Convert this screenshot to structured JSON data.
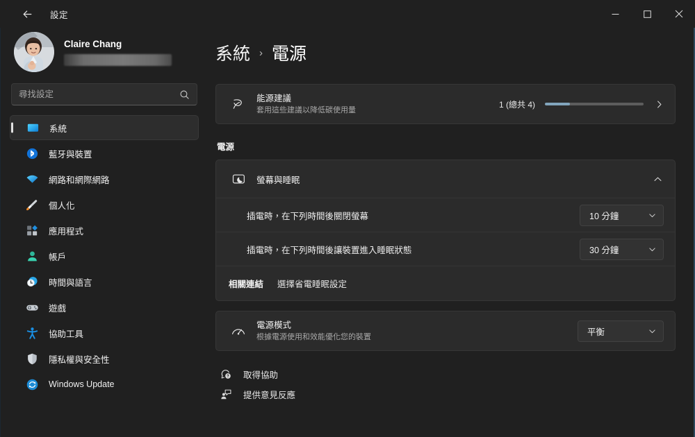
{
  "window": {
    "title": "設定",
    "back_tooltip": "上一頁",
    "minimize_label": "─",
    "maximize_label": "☐",
    "close_label": "✕"
  },
  "account": {
    "name": "Claire Chang",
    "email_masked": ""
  },
  "search": {
    "value": "",
    "placeholder": "尋找設定"
  },
  "sidebar": {
    "items": [
      {
        "label": "系統",
        "icon": "display-icon",
        "active": true
      },
      {
        "label": "藍牙與裝置",
        "icon": "bluetooth-icon",
        "active": false
      },
      {
        "label": "網路和網際網路",
        "icon": "wifi-icon",
        "active": false
      },
      {
        "label": "個人化",
        "icon": "paintbrush-icon",
        "active": false
      },
      {
        "label": "應用程式",
        "icon": "apps-icon",
        "active": false
      },
      {
        "label": "帳戶",
        "icon": "account-icon",
        "active": false
      },
      {
        "label": "時間與語言",
        "icon": "clock-icon",
        "active": false
      },
      {
        "label": "遊戲",
        "icon": "gamepad-icon",
        "active": false
      },
      {
        "label": "協助工具",
        "icon": "accessibility-icon",
        "active": false
      },
      {
        "label": "隱私權與安全性",
        "icon": "shield-icon",
        "active": false
      },
      {
        "label": "Windows Update",
        "icon": "update-icon",
        "active": false
      }
    ]
  },
  "breadcrumb": {
    "parent": "系統",
    "separator": "›",
    "current": "電源"
  },
  "energy": {
    "title": "能源建議",
    "subtitle": "套用這些建議以降低碳使用量",
    "count_text": "1 (總共 4)",
    "progress_percent": 25,
    "progress_fill_color": "#82a5bd",
    "chevron": "›"
  },
  "power_section": {
    "label": "電源",
    "screen_sleep": {
      "header_label": "螢幕與睡眠",
      "expanded": true,
      "rows": [
        {
          "label": "插電時，在下列時間後關閉螢幕",
          "value": "10 分鐘"
        },
        {
          "label": "插電時，在下列時間後讓裝置進入睡眠狀態",
          "value": "30 分鐘"
        }
      ],
      "related": {
        "label": "相關連結",
        "link": "選擇省電睡眠設定"
      }
    },
    "power_mode": {
      "title": "電源模式",
      "subtitle": "根據電源使用和效能優化您的裝置",
      "value": "平衡"
    }
  },
  "footer_links": [
    {
      "label": "取得協助",
      "icon": "help-icon"
    },
    {
      "label": "提供意見反應",
      "icon": "feedback-icon"
    }
  ],
  "colors": {
    "window_bg": "#202020",
    "card_bg": "#2b2b2b",
    "accent_blue": "#4cc2ff",
    "active_pill": "#e2e2e2"
  }
}
